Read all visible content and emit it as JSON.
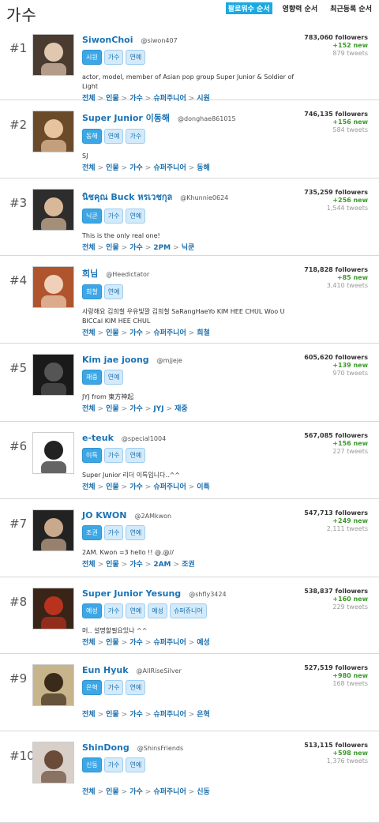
{
  "header": {
    "title": "가수",
    "sort_tabs": [
      {
        "label": "팔로워수 순서",
        "active": true
      },
      {
        "label": "영향력 순서",
        "active": false
      },
      {
        "label": "최근등록 순서",
        "active": false
      }
    ]
  },
  "accent_color": "#1ba9e1",
  "users": [
    {
      "rank": "#1",
      "name": "SiwonChoi",
      "handle": "@siwon407",
      "tags": [
        "시원",
        "가수",
        "연예"
      ],
      "bio": "actor, model, member of Asian pop group Super Junior & Soldier of Light",
      "breadcrumb": [
        "전체",
        "인물",
        "가수",
        "슈퍼주니어",
        "시원"
      ],
      "followers": "783,060 followers",
      "new": "+152 new",
      "tweets": "879 tweets"
    },
    {
      "rank": "#2",
      "name": "Super Junior 이동해",
      "handle": "@donghae861015",
      "tags": [
        "동해",
        "연예",
        "가수"
      ],
      "bio": "SJ",
      "breadcrumb": [
        "전체",
        "인물",
        "가수",
        "슈퍼주니어",
        "동해"
      ],
      "followers": "746,135 followers",
      "new": "+156 new",
      "tweets": "584 tweets"
    },
    {
      "rank": "#3",
      "name": "นิชคุณ Buck หรเวชกุล",
      "handle": "@Khunnie0624",
      "tags": [
        "닉쿤",
        "가수",
        "연예"
      ],
      "bio": "This is the only real one!",
      "breadcrumb": [
        "전체",
        "인물",
        "가수",
        "2PM",
        "닉쿤"
      ],
      "followers": "735,259 followers",
      "new": "+256 new",
      "tweets": "1,544 tweets"
    },
    {
      "rank": "#4",
      "name": "희님",
      "handle": "@Heedictator",
      "tags": [
        "희철",
        "연예"
      ],
      "bio": "사랑해요 김희철 우유빛깔 김희철 SaRangHaeYo KIM HEE CHUL Woo U BICCal KIM HEE CHUL",
      "breadcrumb": [
        "전체",
        "인물",
        "가수",
        "슈퍼주니어",
        "희철"
      ],
      "followers": "718,828 followers",
      "new": "+85 new",
      "tweets": "3,410 tweets"
    },
    {
      "rank": "#5",
      "name": "Kim jae joong",
      "handle": "@mjjeje",
      "tags": [
        "재중",
        "연예"
      ],
      "bio": "JYJ from 東方神起",
      "breadcrumb": [
        "전체",
        "인물",
        "가수",
        "JYJ",
        "재중"
      ],
      "followers": "605,620 followers",
      "new": "+139 new",
      "tweets": "970 tweets"
    },
    {
      "rank": "#6",
      "name": "e-teuk",
      "handle": "@special1004",
      "tags": [
        "이특",
        "가수",
        "연예"
      ],
      "bio": "Super Junior 리더 이특입니다..^^",
      "breadcrumb": [
        "전체",
        "인물",
        "가수",
        "슈퍼주니어",
        "이특"
      ],
      "followers": "567,085 followers",
      "new": "+156 new",
      "tweets": "227 tweets"
    },
    {
      "rank": "#7",
      "name": "JO KWON",
      "handle": "@2AMkwon",
      "tags": [
        "조권",
        "가수",
        "연예"
      ],
      "bio": "2AM. Kwon =3 hello !! @.@//",
      "breadcrumb": [
        "전체",
        "인물",
        "가수",
        "2AM",
        "조권"
      ],
      "followers": "547,713 followers",
      "new": "+249 new",
      "tweets": "2,111 tweets"
    },
    {
      "rank": "#8",
      "name": "Super Junior Yesung",
      "handle": "@shfly3424",
      "tags": [
        "예성",
        "가수",
        "연예",
        "예성",
        "슈퍼쥬니어"
      ],
      "bio": "머.. 설명할필요있나 ^^",
      "breadcrumb": [
        "전체",
        "인물",
        "가수",
        "슈퍼주니어",
        "예성"
      ],
      "followers": "538,837 followers",
      "new": "+160 new",
      "tweets": "229 tweets"
    },
    {
      "rank": "#9",
      "name": "Eun Hyuk",
      "handle": "@AllRiseSilver",
      "tags": [
        "은혁",
        "가수",
        "연예"
      ],
      "bio": "",
      "breadcrumb": [
        "전체",
        "인물",
        "가수",
        "슈퍼주니어",
        "은혁"
      ],
      "followers": "527,519 followers",
      "new": "+980 new",
      "tweets": "168 tweets"
    },
    {
      "rank": "#10",
      "name": "ShinDong",
      "handle": "@ShinsFriends",
      "tags": [
        "신동",
        "가수",
        "연예"
      ],
      "bio": "",
      "breadcrumb": [
        "전체",
        "인물",
        "가수",
        "슈퍼주니어",
        "신동"
      ],
      "followers": "513,115 followers",
      "new": "+598 new",
      "tweets": "1,376 tweets"
    }
  ]
}
